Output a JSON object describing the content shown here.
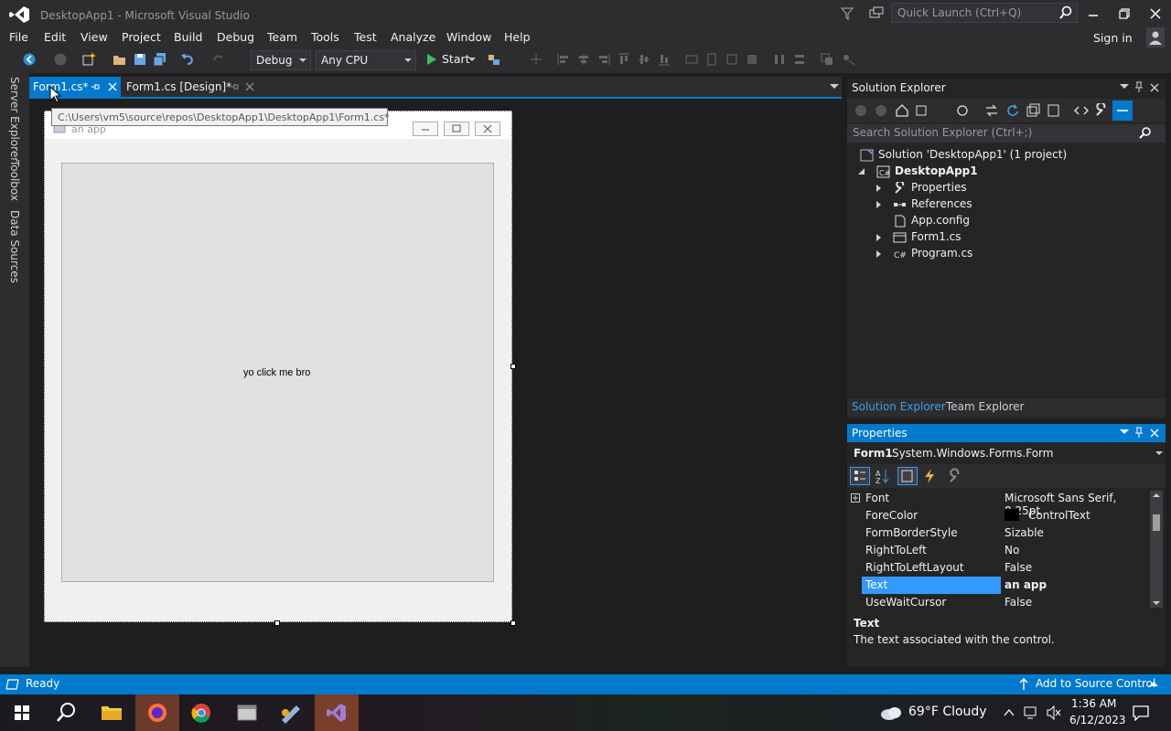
{
  "window": {
    "title": "DesktopApp1 - Microsoft Visual Studio",
    "quick_launch_placeholder": "Quick Launch (Ctrl+Q)",
    "sign_in": "Sign in"
  },
  "menu": [
    "File",
    "Edit",
    "View",
    "Project",
    "Build",
    "Debug",
    "Team",
    "Tools",
    "Test",
    "Analyze",
    "Window",
    "Help"
  ],
  "toolbar": {
    "configuration": "Debug",
    "platform": "Any CPU",
    "start_label": "Start"
  },
  "left_tabs": [
    "Server Explorer",
    "Toolbox",
    "Data Sources"
  ],
  "doc_tabs": {
    "active": "Form1.cs*",
    "second": "Form1.cs [Design]*"
  },
  "designer": {
    "tooltip": "C:\\Users\\vm5\\source\\repos\\DesktopApp1\\DesktopApp1\\Form1.cs*",
    "form_caption": "an app",
    "label_text": "yo click me bro"
  },
  "solution_explorer": {
    "title": "Solution Explorer",
    "search_placeholder": "Search Solution Explorer (Ctrl+;)",
    "solution": "Solution 'DesktopApp1' (1 project)",
    "project": "DesktopApp1",
    "items": [
      "Properties",
      "References",
      "App.config",
      "Form1.cs",
      "Program.cs"
    ],
    "tab_active": "Solution Explorer",
    "tab_other": "Team Explorer"
  },
  "properties": {
    "title": "Properties",
    "object_name": "Form1",
    "object_type": "System.Windows.Forms.Form",
    "rows": [
      {
        "key": "Font",
        "value": "Microsoft Sans Serif, 8.25pt"
      },
      {
        "key": "ForeColor",
        "value": "ControlText"
      },
      {
        "key": "FormBorderStyle",
        "value": "Sizable"
      },
      {
        "key": "RightToLeft",
        "value": "No"
      },
      {
        "key": "RightToLeftLayout",
        "value": "False"
      },
      {
        "key": "Text",
        "value": "an app"
      },
      {
        "key": "UseWaitCursor",
        "value": "False"
      }
    ],
    "desc_title": "Text",
    "desc_text": "The text associated with the control."
  },
  "status": {
    "ready": "Ready",
    "source_control": "Add to Source Control"
  },
  "taskbar": {
    "weather": "69°F  Cloudy",
    "time": "1:36 AM",
    "date": "6/12/2023"
  },
  "colors": {
    "accent": "#007acc",
    "chrome": "#2d2d30",
    "editor_bg": "#1e1e1e",
    "selection": "#3399ff"
  }
}
